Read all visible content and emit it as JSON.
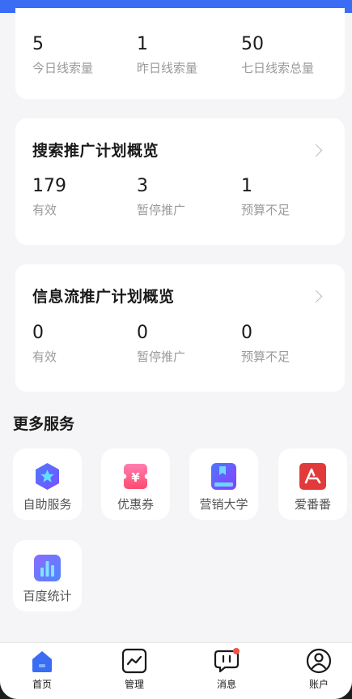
{
  "top_card": {
    "stats": [
      {
        "value": "5",
        "label": "今日线索量"
      },
      {
        "value": "1",
        "label": "昨日线索量"
      },
      {
        "value": "50",
        "label": "七日线索总量"
      }
    ]
  },
  "search_card": {
    "title": "搜索推广计划概览",
    "stats": [
      {
        "value": "179",
        "label": "有效"
      },
      {
        "value": "3",
        "label": "暂停推广"
      },
      {
        "value": "1",
        "label": "预算不足"
      }
    ]
  },
  "feed_card": {
    "title": "信息流推广计划概览",
    "stats": [
      {
        "value": "0",
        "label": "有效"
      },
      {
        "value": "0",
        "label": "暂停推广"
      },
      {
        "value": "0",
        "label": "预算不足"
      }
    ]
  },
  "more_services": {
    "title": "更多服务",
    "items": [
      {
        "label": "自助服务",
        "icon": "self-service-icon"
      },
      {
        "label": "优惠券",
        "icon": "coupon-icon"
      },
      {
        "label": "营销大学",
        "icon": "marketing-university-icon"
      },
      {
        "label": "爱番番",
        "icon": "aifanfan-icon"
      },
      {
        "label": "百度统计",
        "icon": "baidu-stats-icon"
      }
    ]
  },
  "tabbar": {
    "tabs": [
      {
        "label": "首页",
        "icon": "home-icon",
        "active": true
      },
      {
        "label": "管理",
        "icon": "chart-icon",
        "active": false
      },
      {
        "label": "消息",
        "icon": "message-icon",
        "active": false,
        "badge": true
      },
      {
        "label": "账户",
        "icon": "account-icon",
        "active": false
      }
    ]
  },
  "colors": {
    "accent": "#3a6cf4",
    "background": "#f5f5f7",
    "card": "#ffffff",
    "muted_text": "#9a9a9e",
    "badge": "#f4533c"
  }
}
